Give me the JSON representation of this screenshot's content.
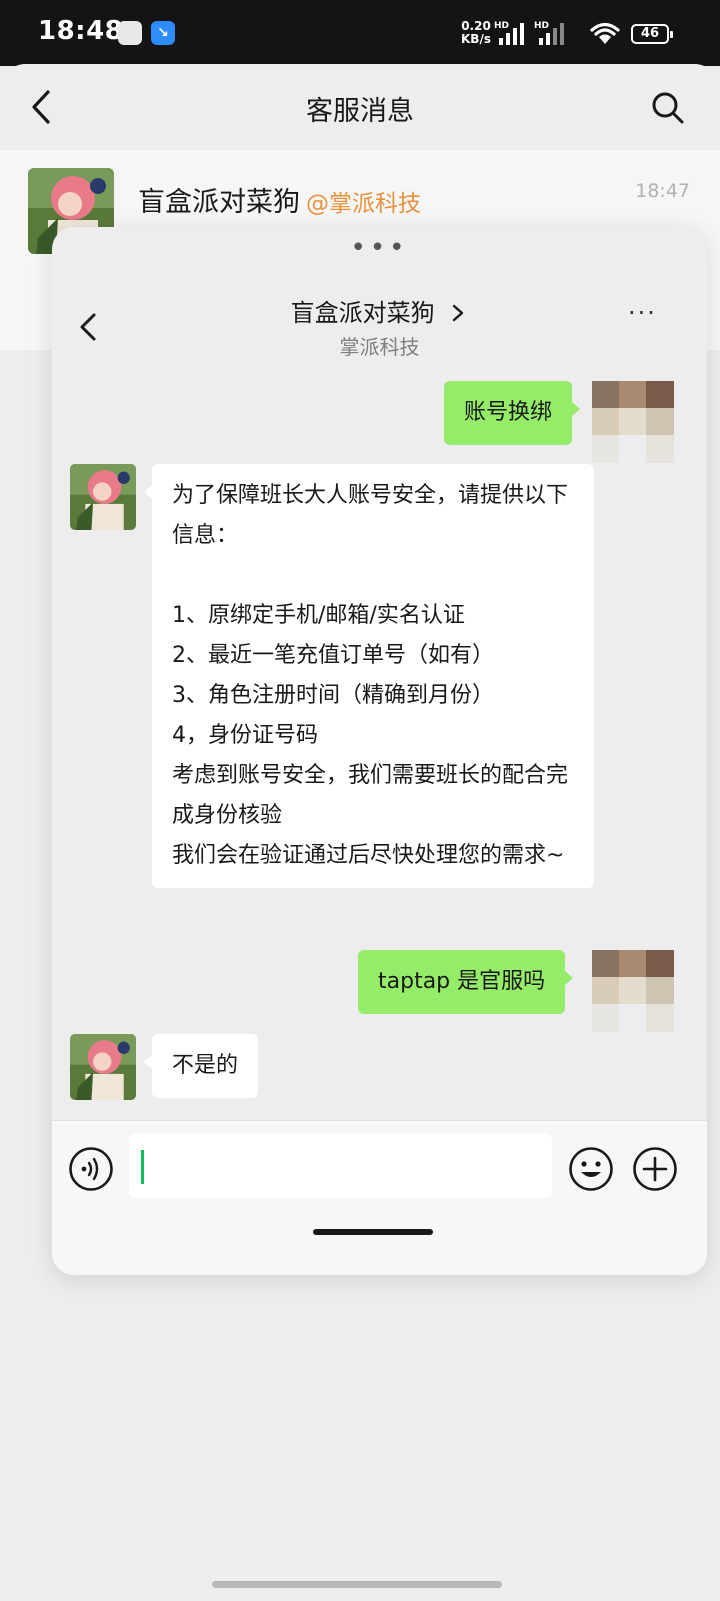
{
  "status_bar": {
    "time": "18:48",
    "net_speed_value": "0.20",
    "net_speed_unit": "KB/s",
    "hd1": "HD",
    "hd2": "HD",
    "battery": "46",
    "app2_glyph": "↘"
  },
  "outer": {
    "title": "客服消息",
    "conversation": {
      "name": "盲盒派对菜狗",
      "tag": "@掌派科技",
      "time": "18:47"
    }
  },
  "dialog": {
    "grip": "•••",
    "title": "盲盒派对菜狗",
    "subtitle": "掌派科技",
    "more": "···"
  },
  "messages": [
    {
      "side": "out",
      "text": "账号换绑"
    },
    {
      "side": "in",
      "text": "为了保障班长大人账号安全，请提供以下信息：\n\n1、原绑定手机/邮箱/实名认证\n2、最近一笔充值订单号（如有）\n3、角色注册时间（精确到月份）\n4，身份证号码\n考虑到账号安全，我们需要班长的配合完成身份核验\n我们会在验证通过后尽快处理您的需求~"
    },
    {
      "side": "out",
      "text": "taptap 是官服吗"
    },
    {
      "side": "in",
      "text": "不是的"
    }
  ],
  "colors": {
    "outgoing_bubble": "#95ec69",
    "incoming_bubble": "#ffffff",
    "tag_orange": "#e8923c",
    "caret_green": "#07c160"
  }
}
